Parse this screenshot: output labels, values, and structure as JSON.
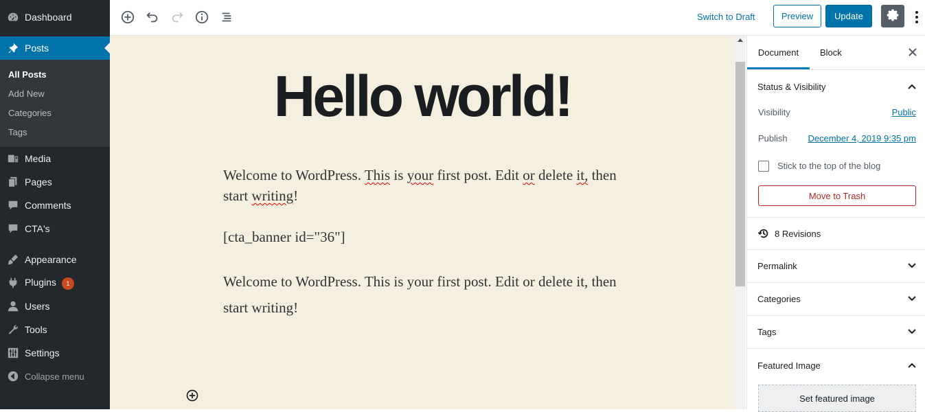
{
  "admin_menu": {
    "items": [
      {
        "label": "Dashboard"
      },
      {
        "label": "Posts"
      },
      {
        "label": "Media"
      },
      {
        "label": "Pages"
      },
      {
        "label": "Comments"
      },
      {
        "label": "CTA's"
      },
      {
        "label": "Appearance"
      },
      {
        "label": "Plugins",
        "badge": "1"
      },
      {
        "label": "Users"
      },
      {
        "label": "Tools"
      },
      {
        "label": "Settings"
      }
    ],
    "submenu": [
      "All Posts",
      "Add New",
      "Categories",
      "Tags"
    ],
    "collapse_label": "Collapse menu"
  },
  "toolbar": {
    "switch_draft": "Switch to Draft",
    "preview": "Preview",
    "update": "Update"
  },
  "post": {
    "title": "Hello world!",
    "paragraph1_words": [
      "Welcome to WordPress.",
      "This",
      "is",
      "your",
      "first post. Edit",
      "or",
      "delete",
      "it,",
      "then",
      "start",
      "writing",
      "!"
    ],
    "shortcode": "[cta_banner id=\"36\"]",
    "paragraph3_line1": "Welcome to WordPress. This is your first post. Edit or delete it, then",
    "paragraph3_line2": "start writing!"
  },
  "sidebar": {
    "tab_document": "Document",
    "tab_block": "Block",
    "status_title": "Status & Visibility",
    "visibility_label": "Visibility",
    "visibility_value": "Public",
    "publish_label": "Publish",
    "publish_value": "December 4, 2019 9:35 pm",
    "sticky_label": "Stick to the top of the blog",
    "trash_label": "Move to Trash",
    "revisions": "8 Revisions",
    "panels": [
      "Permalink",
      "Categories",
      "Tags"
    ],
    "featured_title": "Featured Image",
    "featured_button": "Set featured image"
  },
  "colors": {
    "accent": "#0073aa",
    "admin_bg": "#23282d",
    "canvas_bg": "#f5efe0",
    "trash": "#b52727"
  }
}
